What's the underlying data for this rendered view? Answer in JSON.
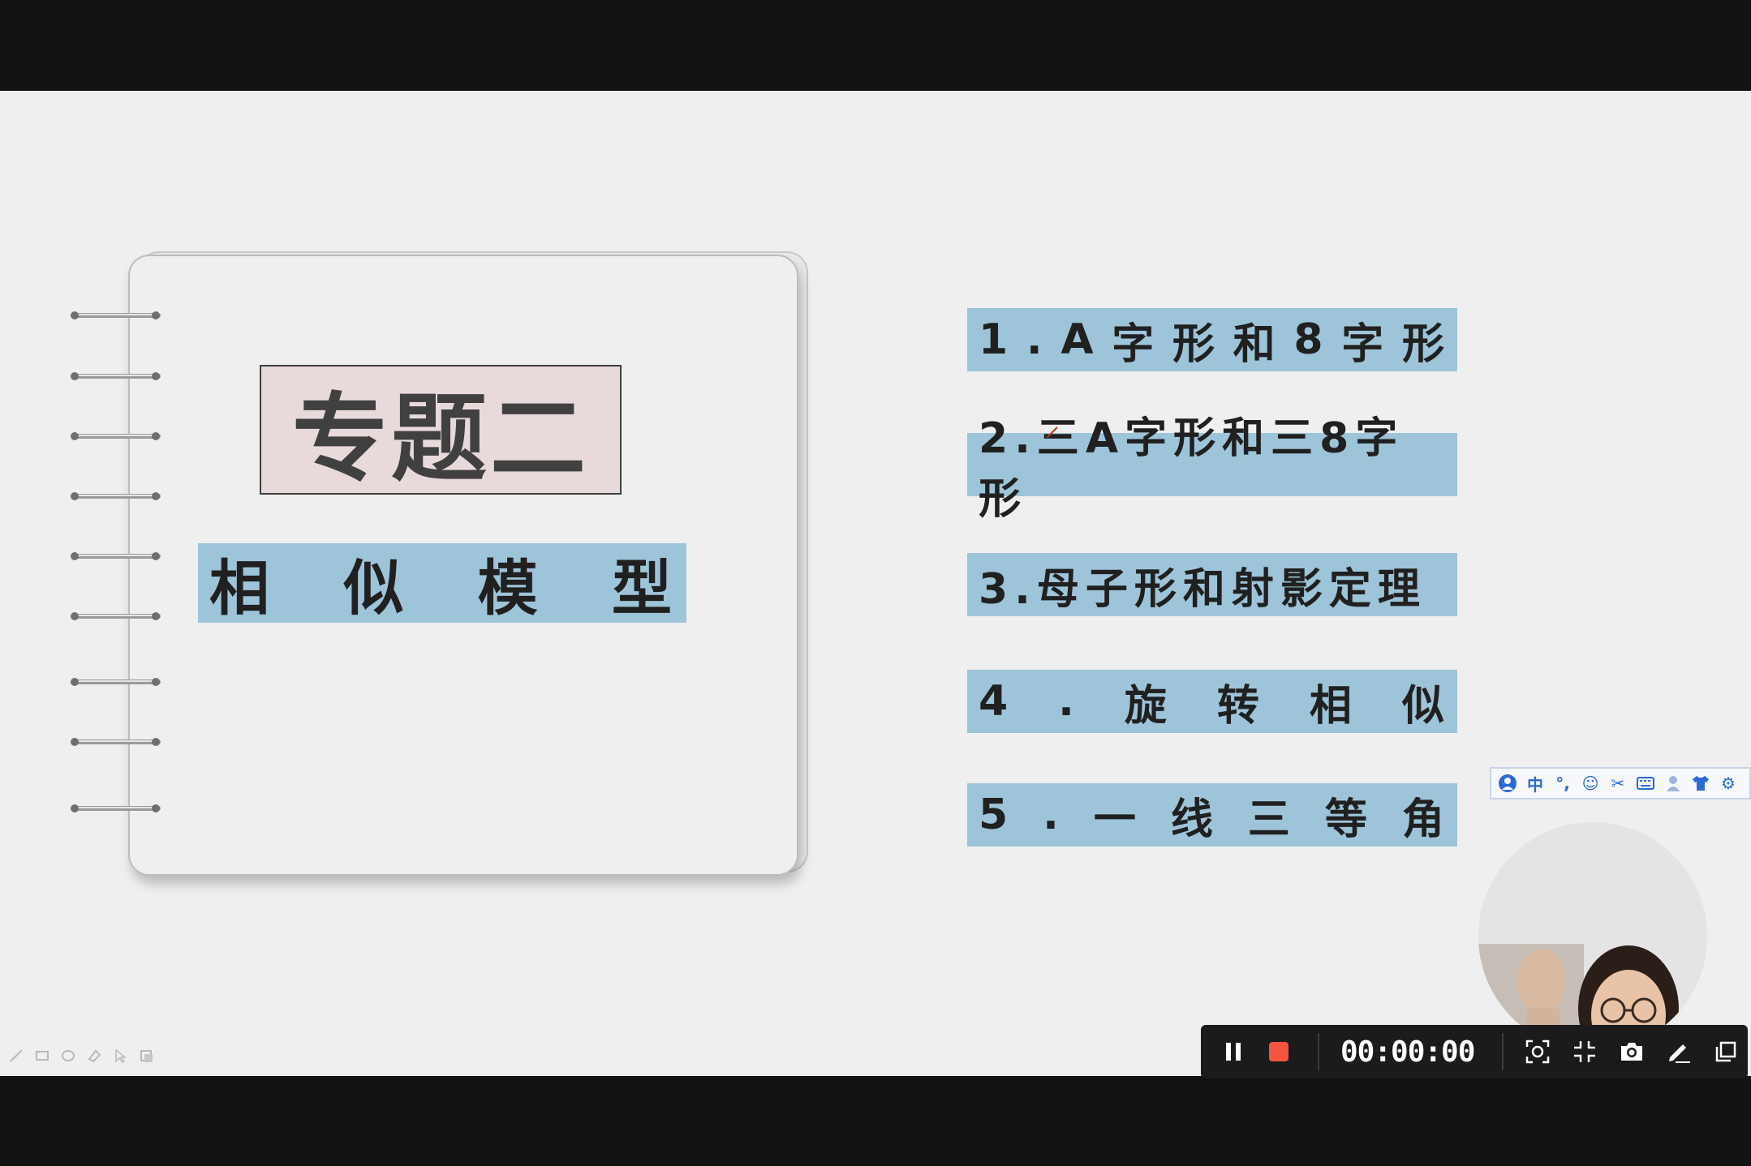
{
  "slide": {
    "title": "专题二",
    "subtitle_chars": [
      "相",
      "似",
      "模",
      "型"
    ],
    "topics": [
      {
        "chars": [
          "1",
          ".",
          "A",
          "字",
          "形",
          "和",
          "8",
          "字",
          "形"
        ]
      },
      {
        "chars": [
          "2.三A字形和三8字形"
        ]
      },
      {
        "chars": [
          "3.母子形和射影定理"
        ]
      },
      {
        "chars": [
          "4",
          ".",
          "旋",
          "转",
          "相",
          "似"
        ]
      },
      {
        "chars": [
          "5",
          ".",
          "一",
          "线",
          "三",
          "等",
          "角"
        ]
      }
    ]
  },
  "ime_toolbar": {
    "mode_label": "中",
    "icons": [
      "ime-logo-icon",
      "punctuation-icon",
      "emoji-icon",
      "scissors-icon",
      "keyboard-icon",
      "user-icon",
      "skin-icon",
      "settings-icon"
    ]
  },
  "recorder": {
    "timer": "00:00:00",
    "icons": [
      "pause-icon",
      "stop-icon",
      "region-capture-icon",
      "shrink-icon",
      "camera-icon",
      "pen-icon",
      "window-icon"
    ]
  },
  "colors": {
    "topic_bg": "#9ec4da",
    "title_bg": "#e8d9da",
    "slide_bg": "#efeff0",
    "stop_red": "#f4553f"
  }
}
